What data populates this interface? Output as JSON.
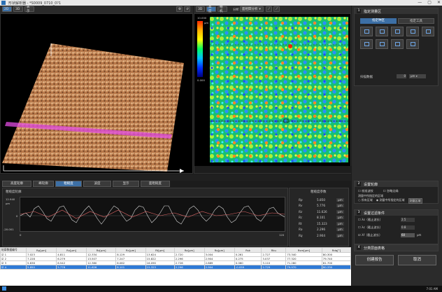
{
  "window": {
    "title": "形状解析器 - *S0009_0710_0?1",
    "controls": [
      "—",
      "▢",
      "✕"
    ]
  },
  "left_toolbar": {
    "buttons": [
      "2D",
      "3D",
      "表示"
    ],
    "right": [
      "⚙",
      "↺"
    ]
  },
  "center_toolbar": {
    "buttons": [
      "3D",
      "高度",
      "相机"
    ],
    "select_label": "分析",
    "select_value": "面相関分析"
  },
  "colorbar": {
    "top": "10.000",
    "bottom": "0.000",
    "unit": "μm"
  },
  "right_panel": {
    "section1": {
      "num": "1",
      "title": "指定测量区",
      "tabs": [
        "指定种区",
        "指定工具"
      ],
      "label_bottom": "扫描数据",
      "value": "0",
      "unit": "μm"
    },
    "section2": {
      "num": "2",
      "title": "设置轮廓",
      "options": [
        "校准波纹",
        "忽略边缘"
      ],
      "sub_label": "测量中所指定的区域",
      "radio": [
        "所有区域",
        "测量中所指定的区域"
      ],
      "radio_btn": "测量区域"
    },
    "section3": {
      "num": "3",
      "title": "设置过滤条件",
      "rows": [
        {
          "label": "λs（截止波长）",
          "value": "2.5"
        },
        {
          "label": "λc（截止波长）",
          "value": "0.8"
        },
        {
          "label": "λf（截止波长）",
          "value": "60"
        }
      ],
      "unit": "μm"
    },
    "section4": {
      "num": "4",
      "title": "分类层面表格"
    }
  },
  "bottom_tabs": [
    "高度轮廓",
    "峰轮廓",
    "粗糙度",
    "波度",
    "显示",
    "面粗糙度"
  ],
  "profile_panel": {
    "title": "粗糙度轮廓",
    "y_top": "12.940",
    "y_unit": "μm",
    "y_bottom": "-20.001",
    "x_left": "0",
    "x_right": "120",
    "zero": "0"
  },
  "params_panel": {
    "title": "粗糙度参数",
    "rows": [
      {
        "k": "Rp",
        "v": "5.850",
        "u": "μm"
      },
      {
        "k": "Rv",
        "v": "5.776",
        "u": "μm"
      },
      {
        "k": "Rz",
        "v": "11.626",
        "u": "μm"
      },
      {
        "k": "Rc",
        "v": "8.101",
        "u": "μm"
      },
      {
        "k": "Rt",
        "v": "15.323",
        "u": "μm"
      },
      {
        "k": "Ra",
        "v": "2.296",
        "u": "μm"
      },
      {
        "k": "Rq",
        "v": "2.904",
        "u": "μm"
      }
    ]
  },
  "table": {
    "headers": [
      "轮廓数据编号",
      "Rp[μm]",
      "Rv[μm]",
      "Rz[μm]",
      "Rc[μm]",
      "Rt[μm]",
      "Ra[μm]",
      "Rq[μm]",
      "Rsk",
      "Rku",
      "Rsm[μm]",
      "Rdq[°]"
    ],
    "rows": [
      {
        "cells": [
          "1",
          "7.023",
          "4.811",
          "12.334",
          "8.129",
          "13.624",
          "2.720",
          "3.004",
          "0.261",
          "2.727",
          "73.340",
          "80.300"
        ],
        "selected": false
      },
      {
        "cells": [
          "2",
          "7.228",
          "6.279",
          "13.507",
          "7.247",
          "15.822",
          "2.296",
          "2.904",
          "0.275",
          "3.037",
          "77.320",
          "79.740"
        ],
        "selected": false
      },
      {
        "cells": [
          "3",
          "5.838",
          "6.542",
          "12.380",
          "8.082",
          "16.090",
          "2.726",
          "2.889",
          "0.060",
          "3.110",
          "71.280",
          "81.700"
        ],
        "selected": false
      },
      {
        "cells": [
          "4",
          "5.850",
          "5.776",
          "11.626",
          "8.101",
          "15.323",
          "2.296",
          "2.904",
          "-0.059",
          "2.729",
          "79.970",
          "80.330"
        ],
        "selected": true
      }
    ]
  },
  "footer_buttons": [
    "创建报告",
    "取消"
  ],
  "clock": {
    "time": "7:01 AM"
  }
}
